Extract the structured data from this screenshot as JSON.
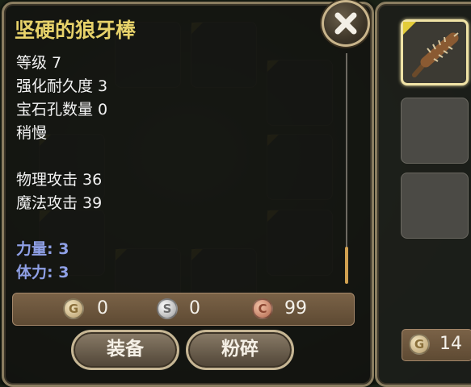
{
  "item": {
    "name": "坚硬的狼牙棒",
    "level": "等级 7",
    "durability": "强化耐久度 3",
    "gem_slots": "宝石孔数量 0",
    "speed": "稍慢",
    "physical_attack": "物理攻击 36",
    "magic_attack": "魔法攻击 39",
    "bonus_strength": "力量: 3",
    "bonus_stamina": "体力: 3"
  },
  "currency": {
    "gold_symbol": "G",
    "gold_value": "0",
    "silver_symbol": "S",
    "silver_value": "0",
    "copper_symbol": "C",
    "copper_value": "99"
  },
  "buttons": {
    "equip_label": "装备",
    "smash_label": "粉碎"
  },
  "inventory": {
    "money_symbol": "G",
    "money_value": "14"
  },
  "colors": {
    "title": "#e7d26a",
    "stats": "#f2f2f2",
    "bonus": "#8fa0e6",
    "frame": "#8a7d60"
  },
  "icons": {
    "close": "close-x-icon",
    "weapon": "spiked-club-icon"
  }
}
